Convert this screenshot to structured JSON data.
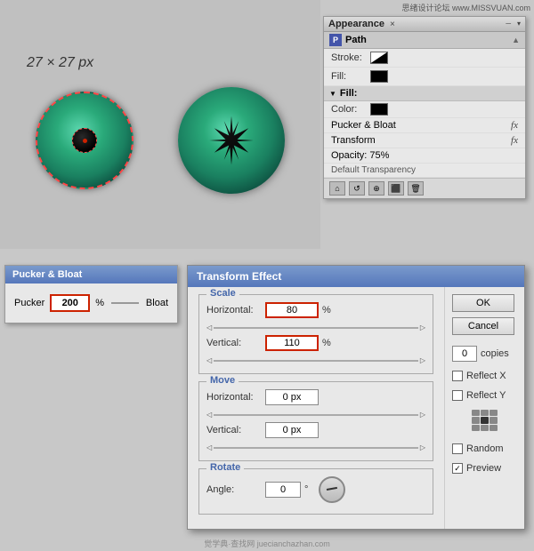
{
  "watermark": {
    "text": "思绪设计论坛 www.MISSVUAN.com"
  },
  "canvas": {
    "dimension_label": "27 × 27 px"
  },
  "appearance_panel": {
    "title": "Appearance",
    "close_label": "×",
    "section_header": "Path",
    "stroke_label": "Stroke:",
    "fill_label": "Fill:",
    "fill_section": "▼Fill:",
    "color_label": "Color:",
    "pucker_bloat_label": "Pucker & Bloat",
    "transform_label": "Transform",
    "opacity_label": "Opacity: 75%",
    "default_transparency": "Default Transparency"
  },
  "pucker_bloat": {
    "title": "Pucker & Bloat",
    "pucker_label": "Pucker",
    "value": "200",
    "percent": "%",
    "bloat_label": "Bloat"
  },
  "transform_effect": {
    "title": "Transform Effect",
    "scale_section": "Scale",
    "horizontal_label": "Horizontal:",
    "horizontal_value": "80",
    "vertical_label": "Vertical:",
    "vertical_value": "110",
    "move_section": "Move",
    "move_h_label": "Horizontal:",
    "move_h_value": "0 px",
    "move_v_label": "Vertical:",
    "move_v_value": "0 px",
    "rotate_section": "Rotate",
    "angle_label": "Angle:",
    "angle_value": "0",
    "ok_label": "OK",
    "cancel_label": "Cancel",
    "copies_label": "copies",
    "copies_value": "0",
    "reflect_x": "Reflect X",
    "reflect_y": "Reflect Y",
    "random_label": "Random",
    "preview_label": "Preview",
    "percent": "%",
    "degree": "°"
  },
  "bottom_watermark": {
    "text": "觉学典·查找网  juecianchazhan.com"
  }
}
